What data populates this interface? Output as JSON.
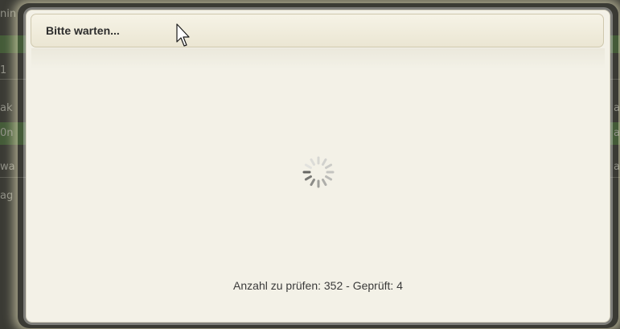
{
  "background": {
    "left_fragments": [
      "nin",
      "1 ",
      "ak",
      "0n",
      "wa",
      "ag"
    ],
    "right_fragments": [
      "a",
      "a",
      "a"
    ]
  },
  "dialog": {
    "title": "Bitte warten...",
    "status": "Anzahl zu prüfen: 352 - Geprüft: 4"
  },
  "icons": {
    "spinner": "loading-spinner-icon",
    "cursor": "mouse-pointer-icon"
  },
  "colors": {
    "dialog_bg": "#f3f1e7",
    "header_border": "#cfc8ae",
    "glow": "#f5f0c8",
    "background_accent": "#46613a"
  }
}
